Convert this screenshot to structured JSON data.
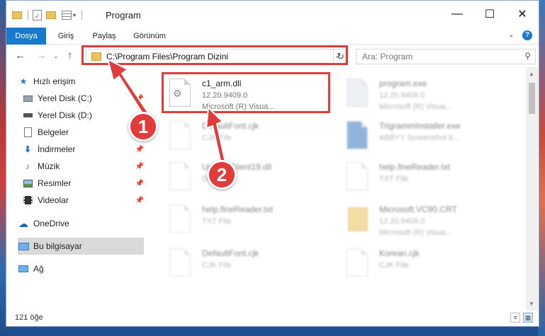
{
  "window": {
    "title": "Program",
    "controls": {
      "minimize": "—",
      "maximize": "☐",
      "close": "✕"
    }
  },
  "ribbon": {
    "tabs": [
      "Dosya",
      "Giriş",
      "Paylaş",
      "Görünüm"
    ]
  },
  "nav": {
    "address": "C:\\Program Files\\Program Dizini",
    "search_placeholder": "Ara: Program"
  },
  "sidebar": {
    "items": [
      {
        "label": "Hızlı erişim",
        "icon": "star-icon"
      },
      {
        "label": "Yerel Disk (C:)",
        "icon": "drive-icon",
        "pinned": true
      },
      {
        "label": "Yerel Disk (D:)",
        "icon": "drive-icon"
      },
      {
        "label": "Belgeler",
        "icon": "documents-icon",
        "pinned": true
      },
      {
        "label": "İndirmeler",
        "icon": "download-icon",
        "pinned": true
      },
      {
        "label": "Müzik",
        "icon": "music-icon",
        "pinned": true
      },
      {
        "label": "Resimler",
        "icon": "pictures-icon",
        "pinned": true
      },
      {
        "label": "Videolar",
        "icon": "video-icon",
        "pinned": true
      },
      {
        "label": "OneDrive",
        "icon": "cloud-icon"
      },
      {
        "label": "Bu bilgisayar",
        "icon": "computer-icon",
        "selected": true
      },
      {
        "label": "Ağ",
        "icon": "network-icon"
      }
    ]
  },
  "files": [
    {
      "name": "c1_arm.dll",
      "line2": "12.20.9409.0",
      "line3": "Microsoft (R) Visua...",
      "highlight": true
    },
    {
      "name": "program.exe",
      "line2": "12.20.9409.0",
      "line3": "Microsoft (R) Visua..."
    },
    {
      "name": "DefaultFont.cjk",
      "line2": "CJK File",
      "line3": ""
    },
    {
      "name": "TrigrammInstaller.exe",
      "line2": "ABBYY Screenshot tr...",
      "line3": ""
    },
    {
      "name": "UpdateClient19.dll",
      "line2": "DLL File",
      "line3": ""
    },
    {
      "name": "help.fineReader.txt",
      "line2": "TXT File",
      "line3": ""
    },
    {
      "name": "help.fineReader.txt",
      "line2": "TXT File",
      "line3": ""
    },
    {
      "name": "Microsoft.VC90.CRT",
      "line2": "12.20.9409.0",
      "line3": "Microsoft (R) Visua..."
    },
    {
      "name": "DefaultFont.cjk",
      "line2": "CJK File",
      "line3": ""
    },
    {
      "name": "Korean.cjk",
      "line2": "CJK File",
      "line3": ""
    }
  ],
  "status": {
    "count": "121 öğe"
  },
  "callouts": [
    "1",
    "2"
  ],
  "colors": {
    "accent": "#1979ca",
    "highlight_red": "#e23b3b"
  }
}
